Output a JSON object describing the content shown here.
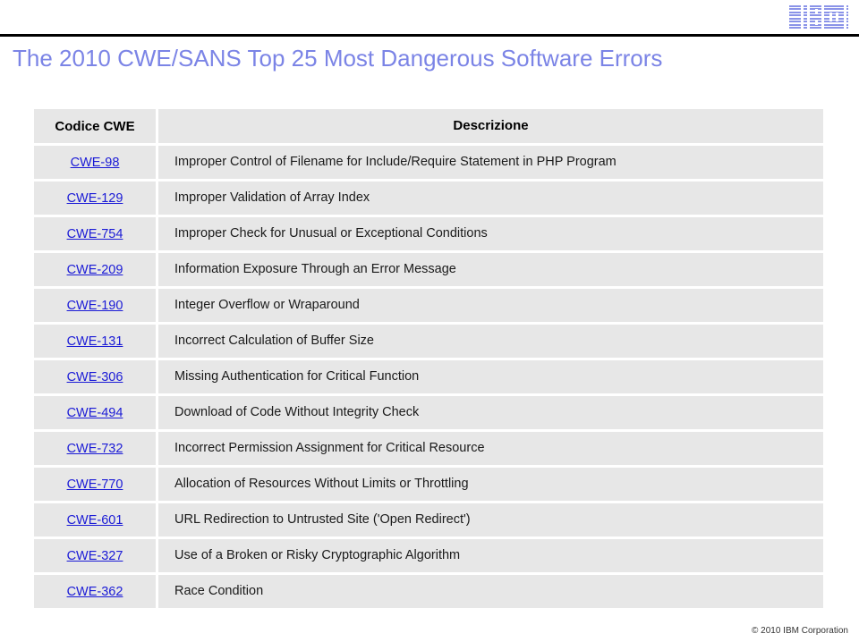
{
  "brand": {
    "logo_name": "IBM",
    "logo_color": "#8a93e8"
  },
  "slide": {
    "title": "The 2010 CWE/SANS Top 25 Most Dangerous Software Errors",
    "title_color": "#7b84e6"
  },
  "table": {
    "headers": {
      "code": "Codice CWE",
      "description": "Descrizione"
    },
    "rows": [
      {
        "code": "CWE-98",
        "description": "Improper Control of Filename for Include/Require Statement in PHP Program"
      },
      {
        "code": "CWE-129",
        "description": "Improper Validation of Array Index"
      },
      {
        "code": "CWE-754",
        "description": "Improper Check for Unusual or Exceptional Conditions"
      },
      {
        "code": "CWE-209",
        "description": "Information Exposure Through an Error Message"
      },
      {
        "code": "CWE-190",
        "description": "Integer Overflow or Wraparound"
      },
      {
        "code": "CWE-131",
        "description": "Incorrect Calculation of Buffer Size"
      },
      {
        "code": "CWE-306",
        "description": "Missing Authentication for Critical Function"
      },
      {
        "code": "CWE-494",
        "description": "Download of Code Without Integrity Check"
      },
      {
        "code": "CWE-732",
        "description": "Incorrect Permission Assignment for Critical Resource"
      },
      {
        "code": "CWE-770",
        "description": "Allocation of Resources Without Limits or Throttling"
      },
      {
        "code": "CWE-601",
        "description": "URL Redirection to Untrusted Site ('Open Redirect')"
      },
      {
        "code": "CWE-327",
        "description": "Use of a Broken or Risky Cryptographic Algorithm"
      },
      {
        "code": "CWE-362",
        "description": "Race Condition"
      }
    ]
  },
  "footer": {
    "copyright": "© 2010 IBM Corporation"
  }
}
